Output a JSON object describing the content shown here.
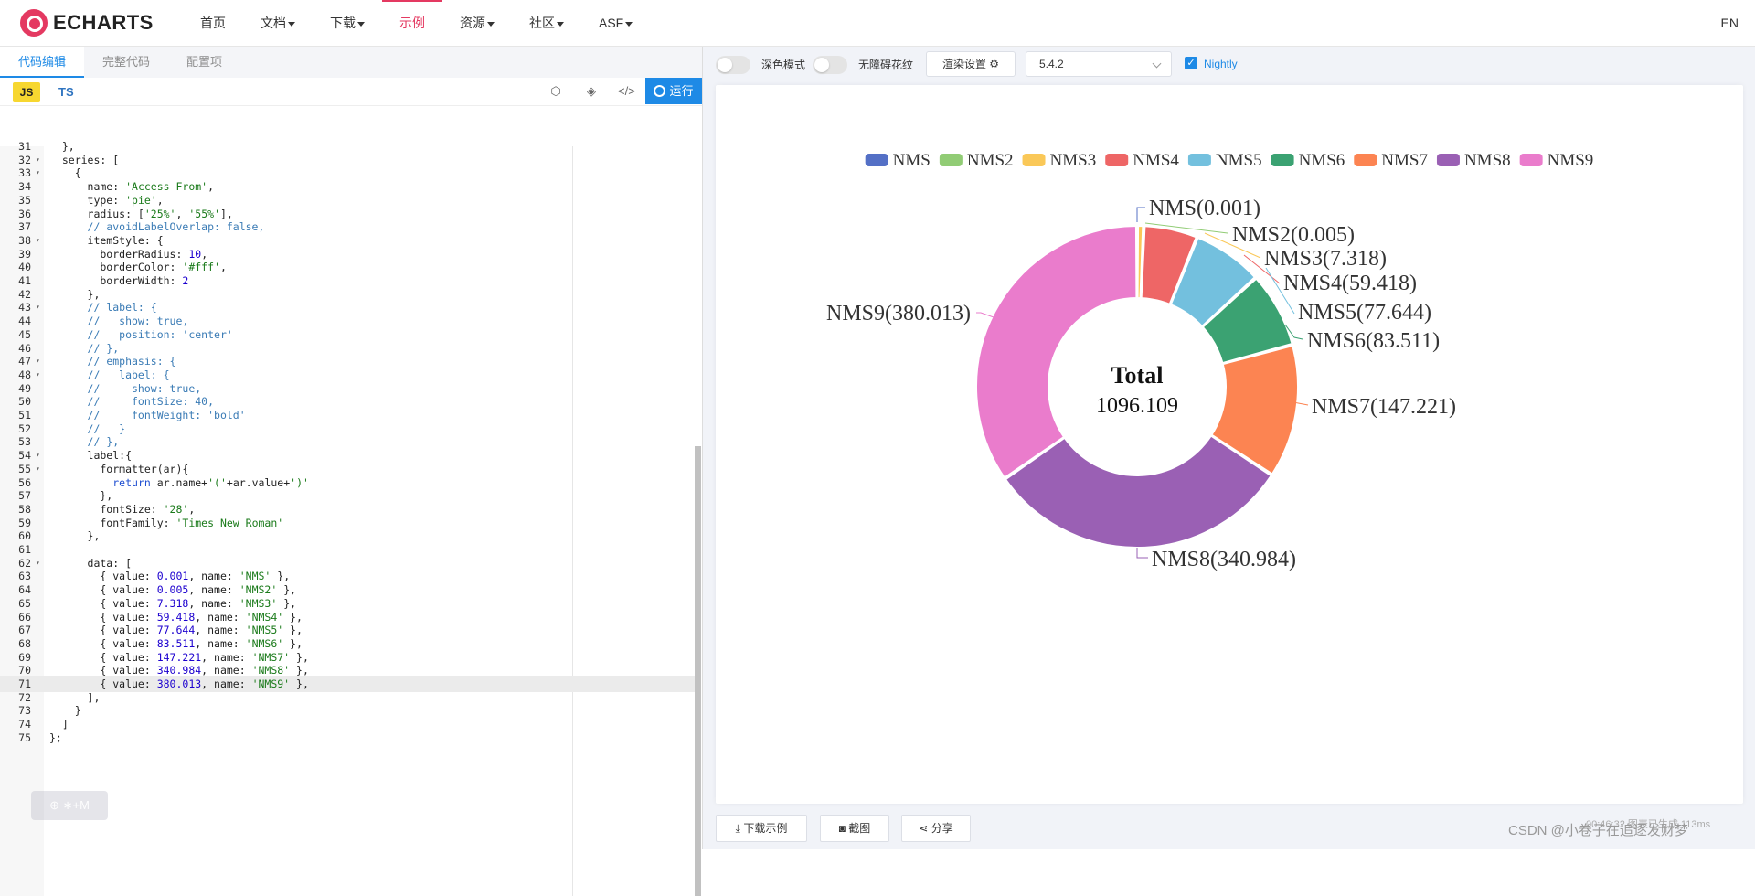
{
  "nav": {
    "logo_text": "ECHARTS",
    "items": [
      {
        "label": "首页",
        "has_caret": false
      },
      {
        "label": "文档",
        "has_caret": true
      },
      {
        "label": "下载",
        "has_caret": true
      },
      {
        "label": "示例",
        "has_caret": false,
        "active": true
      },
      {
        "label": "资源",
        "has_caret": true
      },
      {
        "label": "社区",
        "has_caret": true
      },
      {
        "label": "ASF",
        "has_caret": true
      }
    ],
    "lang": "EN"
  },
  "editor": {
    "tabs": [
      "代码编辑",
      "完整代码",
      "配置项"
    ],
    "active_tab": "代码编辑",
    "lang_js": "JS",
    "lang_ts": "TS",
    "run_label": "运行",
    "lines": [
      {
        "n": "31",
        "text": "  },",
        "fold": false
      },
      {
        "n": "32",
        "text": "  series: [",
        "fold": true
      },
      {
        "n": "33",
        "text": "    {",
        "fold": true
      },
      {
        "n": "34",
        "text": "      name: 'Access From',",
        "fold": false
      },
      {
        "n": "35",
        "text": "      type: 'pie',",
        "fold": false
      },
      {
        "n": "36",
        "text": "      radius: ['25%', '55%'],",
        "fold": false
      },
      {
        "n": "37",
        "text": "      // avoidLabelOverlap: false,",
        "fold": false
      },
      {
        "n": "38",
        "text": "      itemStyle: {",
        "fold": true
      },
      {
        "n": "39",
        "text": "        borderRadius: 10,",
        "fold": false
      },
      {
        "n": "40",
        "text": "        borderColor: '#fff',",
        "fold": false
      },
      {
        "n": "41",
        "text": "        borderWidth: 2",
        "fold": false
      },
      {
        "n": "42",
        "text": "      },",
        "fold": false
      },
      {
        "n": "43",
        "text": "      // label: {",
        "fold": true
      },
      {
        "n": "44",
        "text": "      //   show: true,",
        "fold": false
      },
      {
        "n": "45",
        "text": "      //   position: 'center'",
        "fold": false
      },
      {
        "n": "46",
        "text": "      // },",
        "fold": false
      },
      {
        "n": "47",
        "text": "      // emphasis: {",
        "fold": true
      },
      {
        "n": "48",
        "text": "      //   label: {",
        "fold": true
      },
      {
        "n": "49",
        "text": "      //     show: true,",
        "fold": false
      },
      {
        "n": "50",
        "text": "      //     fontSize: 40,",
        "fold": false
      },
      {
        "n": "51",
        "text": "      //     fontWeight: 'bold'",
        "fold": false
      },
      {
        "n": "52",
        "text": "      //   }",
        "fold": false
      },
      {
        "n": "53",
        "text": "      // },",
        "fold": false
      },
      {
        "n": "54",
        "text": "      label:{",
        "fold": true
      },
      {
        "n": "55",
        "text": "        formatter(ar){",
        "fold": true
      },
      {
        "n": "56",
        "text": "          return ar.name+'('+ar.value+')'",
        "fold": false
      },
      {
        "n": "57",
        "text": "        },",
        "fold": false
      },
      {
        "n": "58",
        "text": "        fontSize: '28',",
        "fold": false
      },
      {
        "n": "59",
        "text": "        fontFamily: 'Times New Roman'",
        "fold": false
      },
      {
        "n": "60",
        "text": "      },",
        "fold": false
      },
      {
        "n": "61",
        "text": "",
        "fold": false
      },
      {
        "n": "62",
        "text": "      data: [",
        "fold": true
      },
      {
        "n": "63",
        "text": "        { value: 0.001, name: 'NMS' },",
        "fold": false
      },
      {
        "n": "64",
        "text": "        { value: 0.005, name: 'NMS2' },",
        "fold": false
      },
      {
        "n": "65",
        "text": "        { value: 7.318, name: 'NMS3' },",
        "fold": false
      },
      {
        "n": "66",
        "text": "        { value: 59.418, name: 'NMS4' },",
        "fold": false
      },
      {
        "n": "67",
        "text": "        { value: 77.644, name: 'NMS5' },",
        "fold": false
      },
      {
        "n": "68",
        "text": "        { value: 83.511, name: 'NMS6' },",
        "fold": false
      },
      {
        "n": "69",
        "text": "        { value: 147.221, name: 'NMS7' },",
        "fold": false
      },
      {
        "n": "70",
        "text": "        { value: 340.984, name: 'NMS8' },",
        "fold": false
      },
      {
        "n": "71",
        "text": "        { value: 380.013, name: 'NMS9' },",
        "fold": false,
        "highlight": true
      },
      {
        "n": "72",
        "text": "      ],",
        "fold": false
      },
      {
        "n": "73",
        "text": "    }",
        "fold": false
      },
      {
        "n": "74",
        "text": "  ]",
        "fold": false
      },
      {
        "n": "75",
        "text": "};",
        "fold": false
      }
    ]
  },
  "preview": {
    "dark_mode_label": "深色模式",
    "decal_label": "无障碍花纹",
    "render_settings_label": "渲染设置",
    "version": "5.4.2",
    "nightly_label": "Nightly",
    "nightly_checked": true,
    "footer_buttons": [
      "下载示例",
      "截图",
      "分享"
    ],
    "credit": "CSDN @小卷子在追逐发财梦",
    "render_time_text": "00:46:32 图表已生成 113ms"
  },
  "chart_data": {
    "type": "pie",
    "center_title": "Total",
    "center_value": "1096.109",
    "legend_position": "top",
    "series": [
      {
        "name": "NMS",
        "value": 0.001,
        "label": "NMS(0.001)",
        "color": "#5470c6"
      },
      {
        "name": "NMS2",
        "value": 0.005,
        "label": "NMS2(0.005)",
        "color": "#91cc75"
      },
      {
        "name": "NMS3",
        "value": 7.318,
        "label": "NMS3(7.318)",
        "color": "#fac858"
      },
      {
        "name": "NMS4",
        "value": 59.418,
        "label": "NMS4(59.418)",
        "color": "#ee6666"
      },
      {
        "name": "NMS5",
        "value": 77.644,
        "label": "NMS5(77.644)",
        "color": "#73c0de"
      },
      {
        "name": "NMS6",
        "value": 83.511,
        "label": "NMS6(83.511)",
        "color": "#3ba272"
      },
      {
        "name": "NMS7",
        "value": 147.221,
        "label": "NMS7(147.221)",
        "color": "#fc8452"
      },
      {
        "name": "NMS8",
        "value": 340.984,
        "label": "NMS8(340.984)",
        "color": "#9a60b4"
      },
      {
        "name": "NMS9",
        "value": 380.013,
        "label": "NMS9(380.013)",
        "color": "#ea7ccc"
      }
    ]
  }
}
